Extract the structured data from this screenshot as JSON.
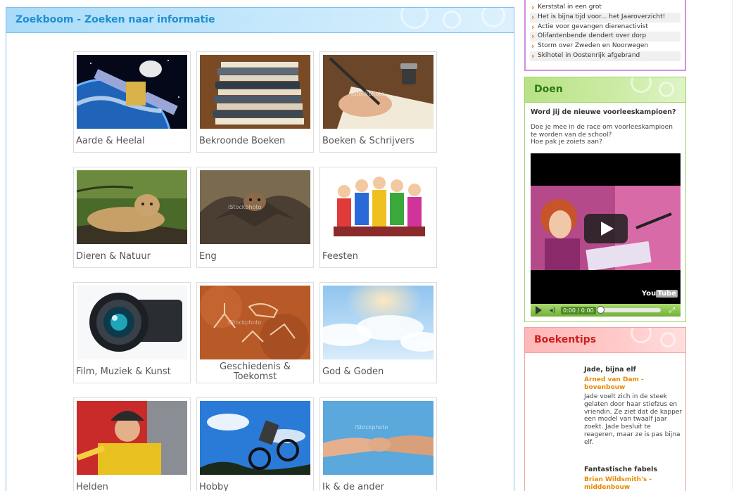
{
  "main": {
    "title": "Zoekboom - Zoeken naar informatie",
    "categories": [
      {
        "label": "Aarde & Heelal",
        "image": "satellite-space"
      },
      {
        "label": "Bekroonde Boeken",
        "image": "book-stack"
      },
      {
        "label": "Boeken & Schrijvers",
        "image": "writing-hand"
      },
      {
        "label": "Dieren & Natuur",
        "image": "lioness"
      },
      {
        "label": "Eng",
        "image": "bat"
      },
      {
        "label": "Feesten",
        "image": "clowns"
      },
      {
        "label": "Film, Muziek & Kunst",
        "image": "camera-lens"
      },
      {
        "label": "Geschiedenis & Toekomst",
        "image": "cave-painting"
      },
      {
        "label": "God & Goden",
        "image": "clouds-sky"
      },
      {
        "label": "Helden",
        "image": "firefighter"
      },
      {
        "label": "Hobby",
        "image": "bmx-rider"
      },
      {
        "label": "Ik & de ander",
        "image": "handshake"
      }
    ]
  },
  "news": {
    "items": [
      "Kerststal in een grot",
      "Het is bijna tijd voor... het Jaaroverzicht!",
      "Actie voor gevangen dierenactivist",
      "Olifantenbende dendert over dorp",
      "Storm over Zweden en Noorwegen",
      "Skihotel in Oostenrijk afgebrand"
    ]
  },
  "doen": {
    "title": "Doen",
    "question": "Word jij de nieuwe voorleeskampioen?",
    "text_line1": "Doe je mee in de race om voorleeskampioen te worden van de school?",
    "text_line2": "Hoe pak je zoiets aan?",
    "video": {
      "time": "0:00 / 0:00",
      "progress": 0,
      "logo_you": "You",
      "logo_tube": "Tube"
    }
  },
  "boekentips": {
    "title": "Boekentips",
    "books": [
      {
        "title": "Jade, bijna elf",
        "author": "Arned van Dam - bovenbouw",
        "description": "Jade voelt zich in de steek gelaten door haar stiefzus en vriendin. Ze ziet dat de kapper een model van twaalf jaar zoekt. Jade besluit te reageren, maar ze is pas bijna elf."
      },
      {
        "title": "Fantastische fabels",
        "author": "Brian Wildsmith's - middenbouw",
        "description": ""
      }
    ]
  },
  "colors": {
    "main_accent": "#1f8fd0",
    "doen_accent": "#2a7a12",
    "boek_accent": "#cc1f1f",
    "author_orange": "#e68a00",
    "news_border": "#d68ee0"
  }
}
